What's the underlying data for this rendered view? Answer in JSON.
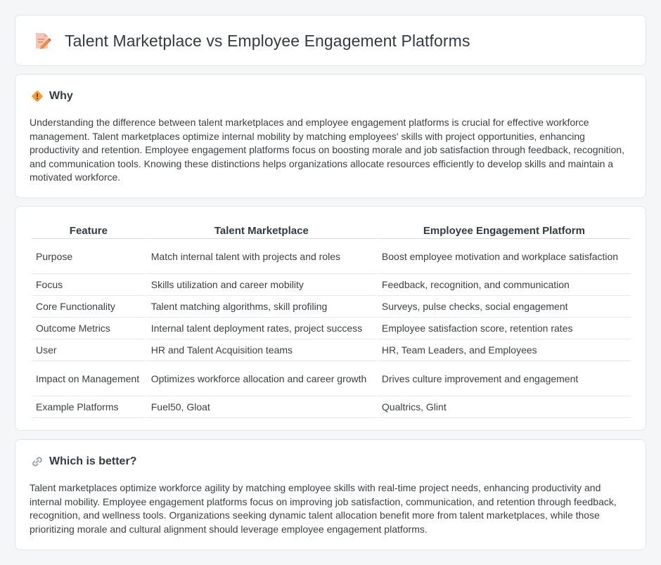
{
  "header": {
    "title": "Talent Marketplace vs Employee Engagement Platforms",
    "icon": "document-pencil-icon"
  },
  "why": {
    "heading": "Why",
    "icon": "diamond-warning-icon",
    "text": "Understanding the difference between talent marketplaces and employee engagement platforms is crucial for effective workforce management. Talent marketplaces optimize internal mobility by matching employees' skills with project opportunities, enhancing productivity and retention. Employee engagement platforms focus on boosting morale and job satisfaction through feedback, recognition, and communication tools. Knowing these distinctions helps organizations allocate resources efficiently to develop skills and maintain a motivated workforce."
  },
  "table": {
    "headers": [
      "Feature",
      "Talent Marketplace",
      "Employee Engagement Platform"
    ],
    "rows": [
      [
        "Purpose",
        "Match internal talent with projects and roles",
        "Boost employee motivation and workplace satisfaction"
      ],
      [
        "Focus",
        "Skills utilization and career mobility",
        "Feedback, recognition, and communication"
      ],
      [
        "Core Functionality",
        "Talent matching algorithms, skill profiling",
        "Surveys, pulse checks, social engagement"
      ],
      [
        "Outcome Metrics",
        "Internal talent deployment rates, project success",
        "Employee satisfaction score, retention rates"
      ],
      [
        "User",
        "HR and Talent Acquisition teams",
        "HR, Team Leaders, and Employees"
      ],
      [
        "Impact on Management",
        "Optimizes workforce allocation and career growth",
        "Drives culture improvement and engagement"
      ],
      [
        "Example Platforms",
        "Fuel50, Gloat",
        "Qualtrics, Glint"
      ]
    ]
  },
  "better": {
    "heading": "Which is better?",
    "icon": "link-icon",
    "text": "Talent marketplaces optimize workforce agility by matching employee skills with real-time project needs, enhancing productivity and internal mobility. Employee engagement platforms focus on improving job satisfaction, communication, and retention through feedback, recognition, and wellness tools. Organizations seeking dynamic talent allocation benefit more from talent marketplaces, while those prioritizing morale and cultural alignment should leverage employee engagement platforms."
  },
  "colors": {
    "background": "#f5f6f8",
    "card": "#ffffff",
    "accent_orange": "#f29b38",
    "text": "#3c4043"
  }
}
